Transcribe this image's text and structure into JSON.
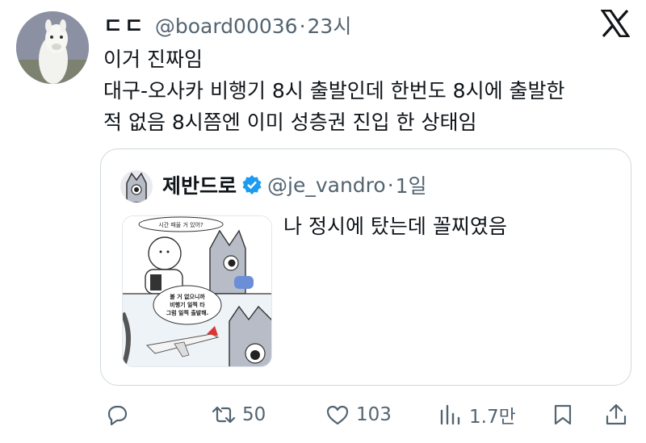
{
  "author": {
    "display_name": "ㄷㄷ",
    "handle": "@board00036",
    "time": "23시",
    "separator": "·",
    "avatar_icon": "alpaca-avatar"
  },
  "brand_icon": "x-logo-icon",
  "tweet_lines": [
    "이거 진짜임",
    "대구-오사카 비행기 8시 출발인데 한번도 8시에 출발한",
    "적 없음 8시쯤엔 이미 성층권 진입 한 상태임"
  ],
  "quote": {
    "display_name": "제반드로",
    "handle": "@je_vandro",
    "time": "1일",
    "separator": "·",
    "verified": true,
    "verified_color": "#1d9bf0",
    "text": "나 정시에 탔는데 꼴찌였음",
    "comic": {
      "bubble_top": "시간 때울 거 있어?",
      "bubble_mid_lines": [
        "볼 거 없으니까",
        "비행기 일찍 타",
        "그럼 일찍 출발해."
      ]
    }
  },
  "actions": {
    "reply_icon": "reply-icon",
    "retweet_icon": "retweet-icon",
    "retweet_count": "50",
    "like_icon": "heart-icon",
    "like_count": "103",
    "views_icon": "views-icon",
    "views_count": "1.7만",
    "bookmark_icon": "bookmark-icon",
    "share_icon": "share-icon"
  },
  "colors": {
    "text_primary": "#0f1419",
    "text_secondary": "#536471",
    "border": "#cfd9de"
  }
}
